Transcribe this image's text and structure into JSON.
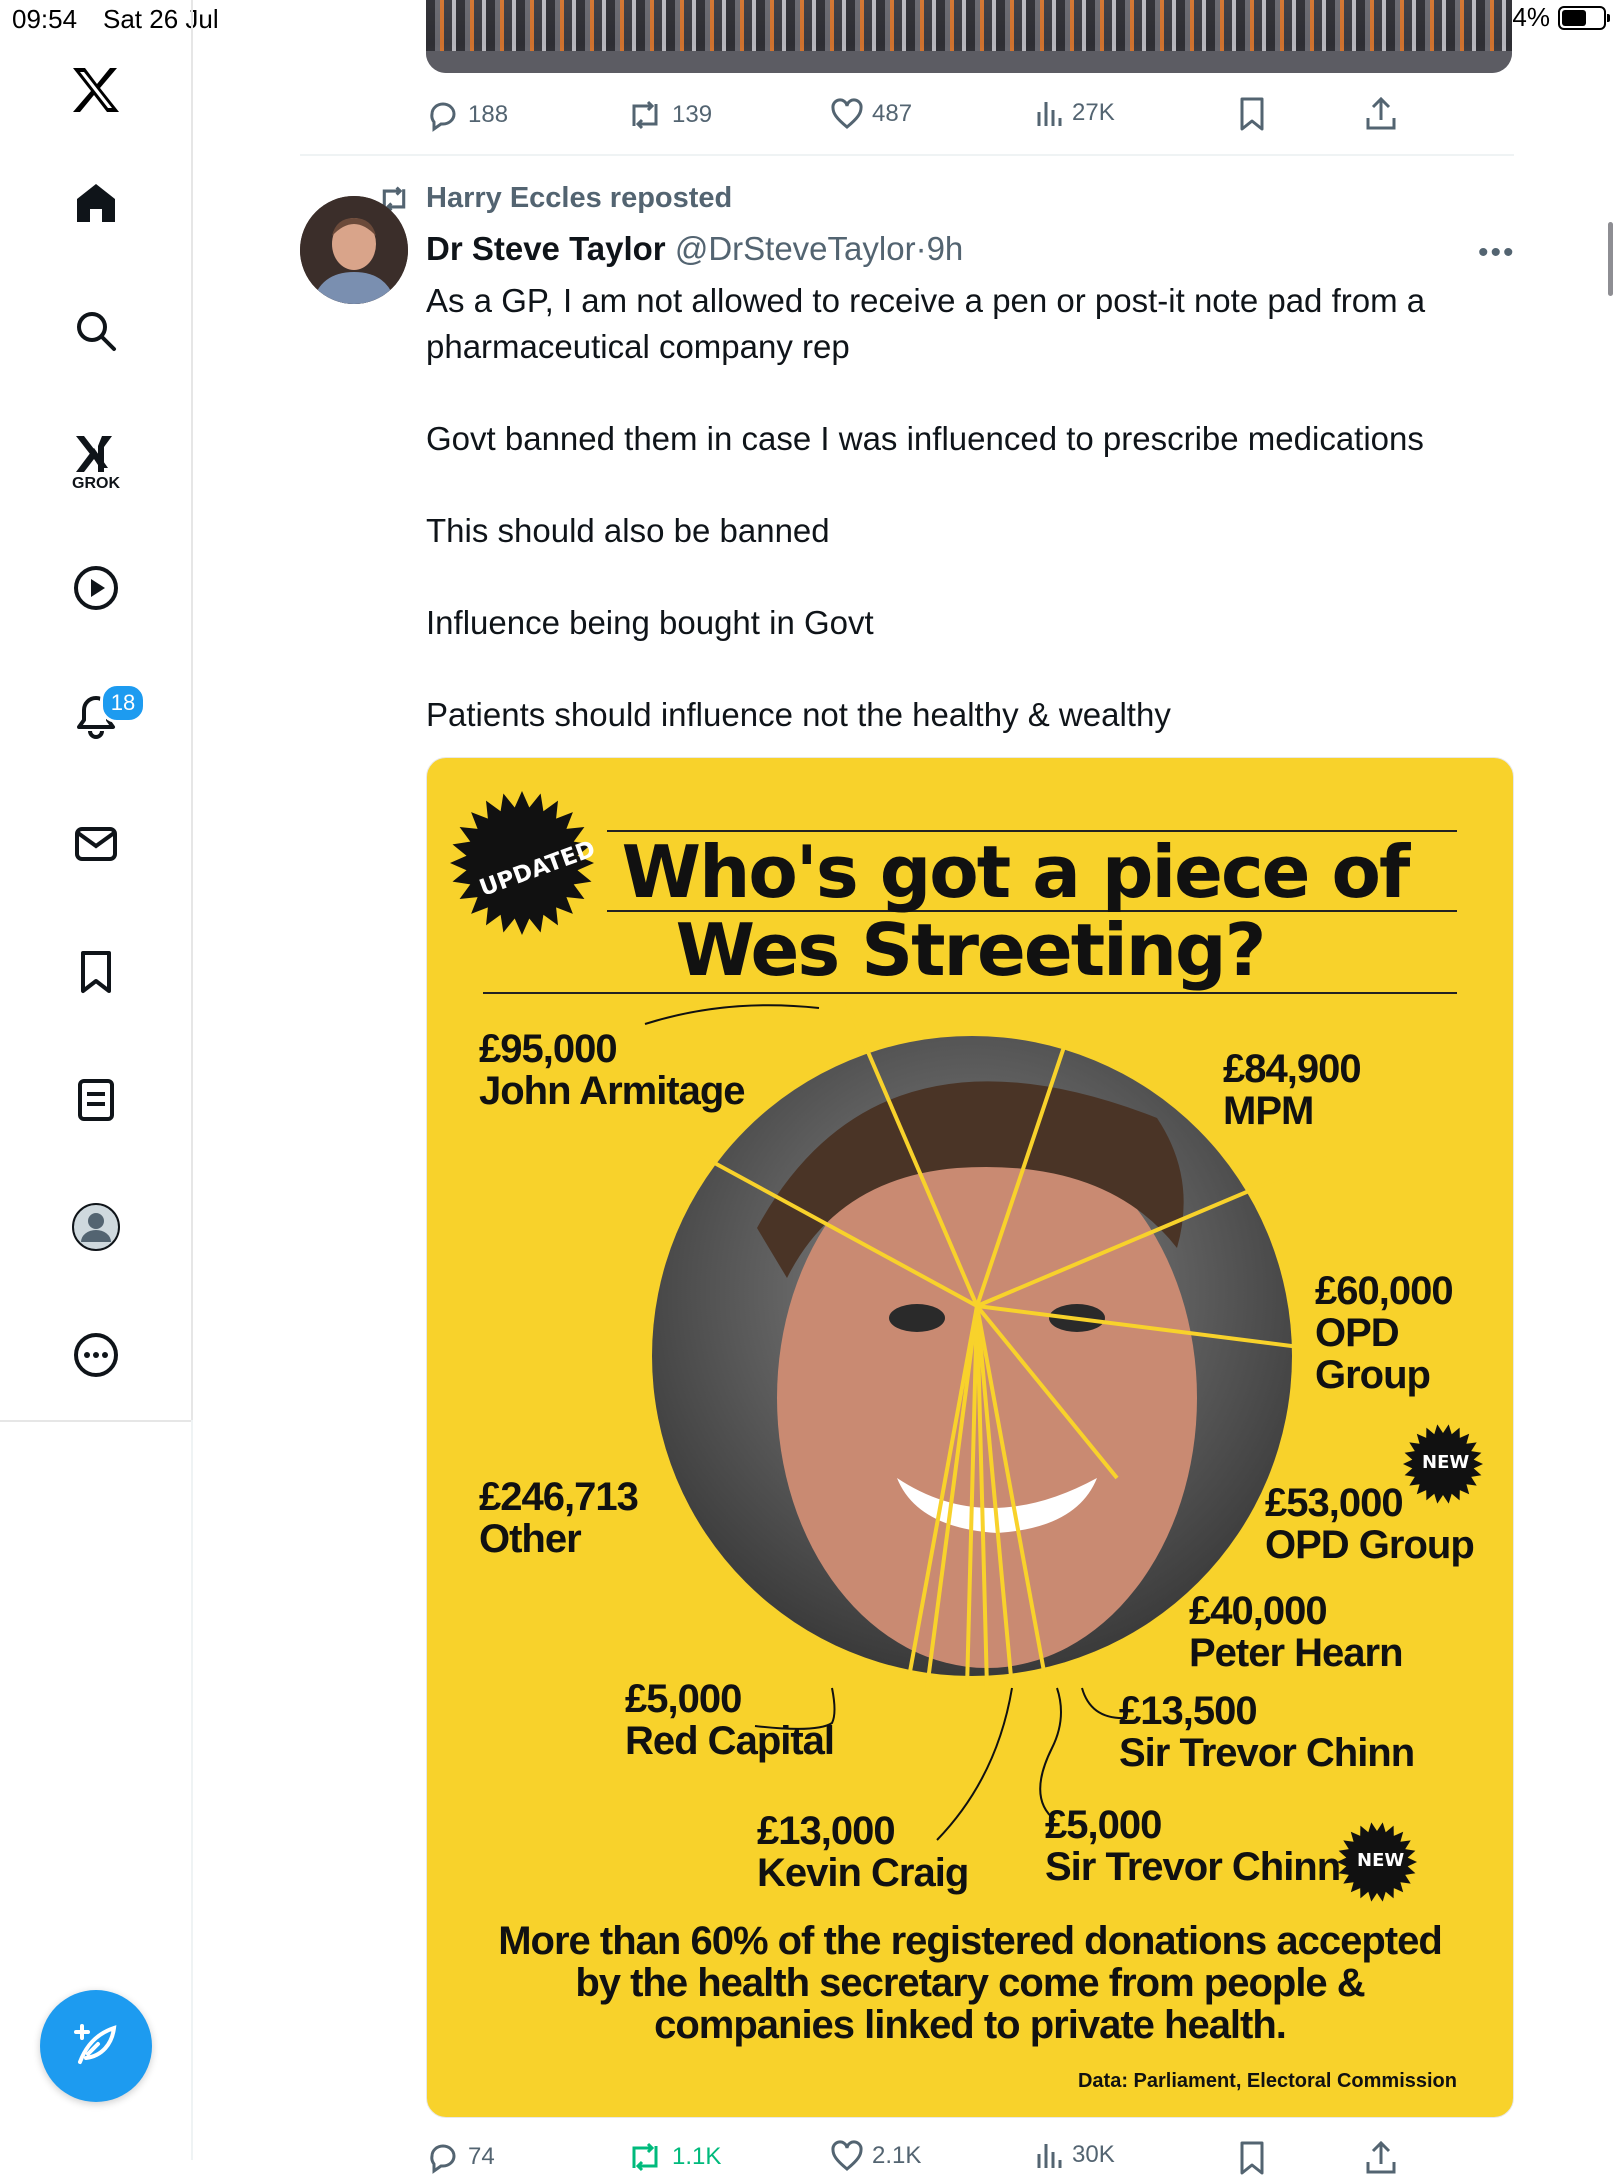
{
  "status_bar": {
    "time": "09:54",
    "date": "Sat 26 Jul",
    "battery": "64%",
    "battery_level": 0.64
  },
  "sidebar": {
    "items": [
      "home",
      "explore",
      "grok",
      "videos",
      "notifications",
      "messages",
      "bookmarks",
      "lists",
      "profile",
      "more"
    ],
    "grok_label": "GROK",
    "notification_count": "18"
  },
  "prev_tweet_actions": {
    "replies": "188",
    "reposts": "139",
    "likes": "487",
    "views": "27K"
  },
  "repost": {
    "label": "Harry Eccles reposted"
  },
  "tweet": {
    "author_name": "Dr Steve Taylor",
    "author_handle": "@DrSteveTaylor",
    "time": "9h",
    "paragraphs": [
      "As a GP, I am not allowed to receive a pen or post-it note pad from a pharmaceutical company rep",
      "Govt banned them in case I was influenced to prescribe medications",
      "This should also be banned",
      "Influence being bought in Govt",
      "Patients should influence not the healthy & wealthy"
    ]
  },
  "infographic": {
    "badge_updated": "UPDATED",
    "title_line1": "Who's got a piece of",
    "title_line2": "Wes Streeting?",
    "new_label": "NEW",
    "labels": {
      "armitage_amount": "£95,000",
      "armitage_name": "John Armitage",
      "mpm_amount": "£84,900",
      "mpm_name": "MPM",
      "opd1_amount": "£60,000",
      "opd1_name1": "OPD",
      "opd1_name2": "Group",
      "opd2_amount": "£53,000",
      "opd2_name": "OPD Group",
      "hearn_amount": "£40,000",
      "hearn_name": "Peter Hearn",
      "other_amount": "£246,713",
      "other_name": "Other",
      "red_amount": "£5,000",
      "red_name": "Red Capital",
      "chinn1_amount": "£13,500",
      "chinn1_name": "Sir Trevor Chinn",
      "craig_amount": "£13,000",
      "craig_name": "Kevin Craig",
      "chinn2_amount": "£5,000",
      "chinn2_name": "Sir Trevor Chinn"
    },
    "footer_line1": "More than 60% of the registered donations accepted",
    "footer_line2": "by the health secretary come from people &",
    "footer_line3": "companies linked to private health.",
    "source": "Data: Parliament, Electoral Commission"
  },
  "tweet_actions": {
    "replies": "74",
    "reposts": "1.1K",
    "likes": "2.1K",
    "views": "30K"
  },
  "colors": {
    "accent": "#1d9bf0",
    "infographic_bg": "#f8d22b",
    "repost_green": "#00ba7c",
    "secondary_text": "#536471"
  }
}
